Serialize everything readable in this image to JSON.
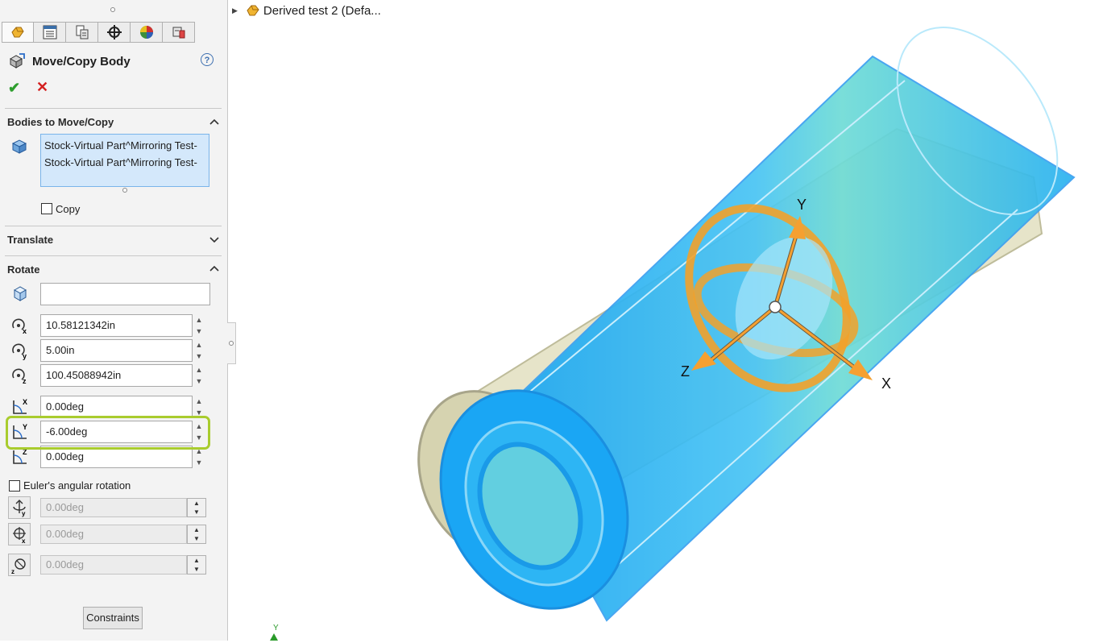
{
  "feature_tree": {
    "root_label": "Derived test 2 (Defa..."
  },
  "property_manager": {
    "tabs": [
      "feature-manager-icon",
      "property-manager-icon",
      "configuration-manager-icon",
      "dimxpert-icon",
      "display-manager-icon",
      "cam-icon"
    ],
    "title": "Move/Copy Body",
    "bodies_section": {
      "title": "Bodies to Move/Copy",
      "items": [
        "Stock-Virtual Part^Mirroring Test-",
        "Stock-Virtual Part^Mirroring Test-"
      ],
      "copy_label": "Copy",
      "copy_checked": false
    },
    "translate_section": {
      "title": "Translate"
    },
    "rotate_section": {
      "title": "Rotate",
      "reference": "",
      "x_origin": "10.58121342in",
      "y_origin": "5.00in",
      "z_origin": "100.45088942in",
      "x_angle": "0.00deg",
      "y_angle": "-6.00deg",
      "z_angle": "0.00deg",
      "euler_label": "Euler's angular rotation",
      "euler_checked": false,
      "euler_values": [
        "0.00deg",
        "0.00deg",
        "0.00deg"
      ]
    },
    "constraints_button": "Constraints"
  },
  "viewport": {
    "triad_labels": {
      "x": "X",
      "y": "Y",
      "z": "Z"
    },
    "orientation_label": "Y"
  }
}
